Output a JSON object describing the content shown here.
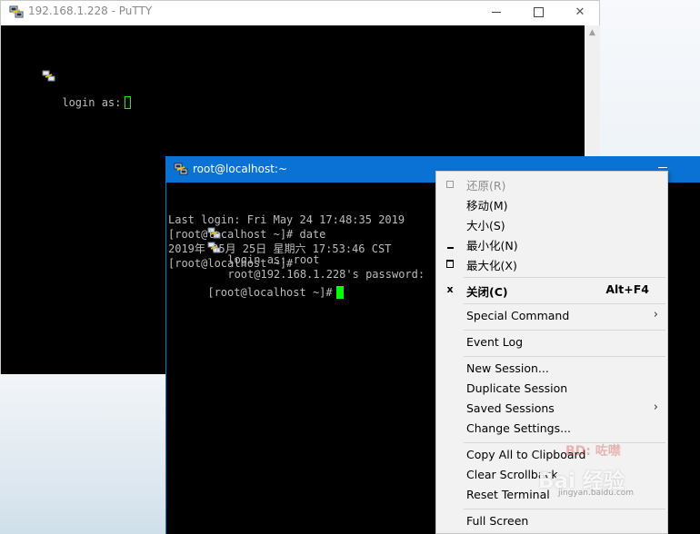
{
  "window_back": {
    "title": "192.168.1.228 - PuTTY",
    "terminal_lines": [
      "login as:"
    ]
  },
  "window_front": {
    "title": "root@localhost:~",
    "terminal_lines": [
      "login as: root",
      "root@192.168.1.228's password:",
      "Last login: Fri May 24 17:48:35 2019",
      "[root@localhost ~]# date",
      "2019年 05月 25日 星期六 17:53:46 CST",
      "[root@localhost ~]#",
      "[root@localhost ~]#"
    ]
  },
  "context_menu": {
    "restore": "还原(R)",
    "move": "移动(M)",
    "size": "大小(S)",
    "minimize": "最小化(N)",
    "maximize": "最大化(X)",
    "close": "关闭(C)",
    "close_accel": "Alt+F4",
    "special_command": "Special Command",
    "event_log": "Event Log",
    "new_session": "New Session...",
    "duplicate_session": "Duplicate Session",
    "saved_sessions": "Saved Sessions",
    "change_settings": "Change Settings...",
    "copy_all": "Copy All to Clipboard",
    "clear_scrollback": "Clear Scrollback",
    "reset_terminal": "Reset Terminal",
    "full_screen": "Full Screen"
  },
  "watermark": {
    "top": "BD: 咗噤",
    "brand": "Bai 经验",
    "sub": "jingyan.baidu.com"
  },
  "colors": {
    "terminal_bg": "#000000",
    "terminal_text": "#bbbbbb",
    "cursor": "#00ff00",
    "titlebar_active": "#0a72d4",
    "menu_bg": "#f2f2f2"
  }
}
